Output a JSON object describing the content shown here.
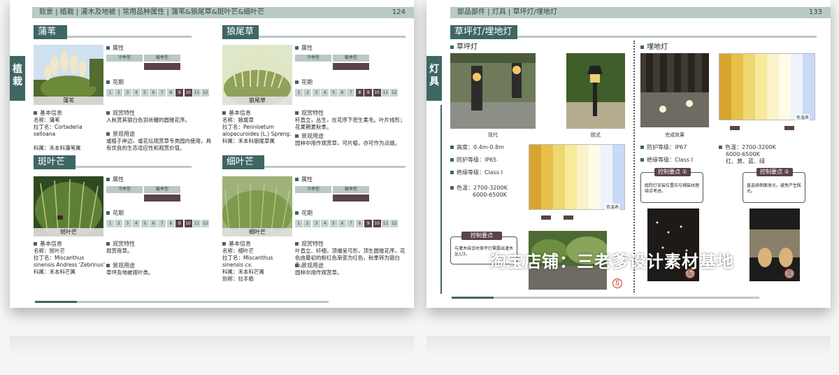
{
  "left_page": {
    "breadcrumb": "软景 | 植栽 | 灌木及地被 | 常用品种属性 | 蒲苇&狼尾草&斑叶芒&细叶芒",
    "page_number": "124",
    "side_tab": "植栽",
    "labels": {
      "attribute": "属性",
      "cool": "冷季型",
      "warm": "暖季型",
      "flowering": "花期",
      "basic_info": "基本信息",
      "ornamental": "观赏特性",
      "landscape_use": "景观用途"
    },
    "months": [
      "1",
      "2",
      "3",
      "4",
      "5",
      "6",
      "7",
      "8",
      "9",
      "10",
      "11",
      "12"
    ],
    "plants": [
      {
        "title": "蒲苇",
        "photo_caption": "蒲苇",
        "warm_season": true,
        "flower_months": [
          9,
          10
        ],
        "name_line": "名称：蒲苇",
        "latin_line": "拉丁名：Cortaderia selloana",
        "family_line": "科属：禾本科蒲苇属",
        "ornamental_text": "入秋赏其银白色羽状穗的圆锥花序。",
        "use_text": "或植于岸边，或花坛观赏草专类园内使用，具有优良的生态适应性和观赏价值。"
      },
      {
        "title": "狼尾草",
        "photo_caption": "狼尾草",
        "warm_season": true,
        "flower_months": [
          8,
          9,
          10
        ],
        "name_line": "名称：狼尾草",
        "latin_line": "拉丁名：Pennisetum alopecuroides (L.) Spreng.",
        "family_line": "科属：禾本科狼尾草属",
        "ornamental_text": "秆直立，丛生，在花序下密生柔毛。叶片线形；花果期夏秋季。",
        "use_text": "园林中用作观赏草，可片植，亦可作为点缀。"
      },
      {
        "title": "斑叶芒",
        "photo_caption": "斑叶芒",
        "warm_season": true,
        "flower_months": [
          9,
          10
        ],
        "name_line": "名称：斑叶芒",
        "latin_line": "拉丁名：Miscanthus sinensis Andress 'Zebrinus'",
        "family_line": "科属：禾本科芒属",
        "ornamental_text": "观赏夜草。",
        "use_text": "草坪及地被观叶类。"
      },
      {
        "title": "细叶芒",
        "photo_caption": "细叶芒",
        "warm_season": true,
        "flower_months": [
          9,
          10
        ],
        "name_line": "名称：细叶芒",
        "latin_line": "拉丁名：Miscanthus sinensis cv.",
        "family_line": "科属：禾本科芒属",
        "alias_line": "别称：拉手筋",
        "ornamental_text": "叶直立、纤细，顶端呈弓形，顶生圆锥花序，花色由最初的粉红色渐变为红色，秋季转为银白色。",
        "use_text": "园林中用作观赏草。"
      }
    ]
  },
  "right_page": {
    "breadcrumb": "部品部件 | 灯具 | 草坪灯/埋地灯",
    "page_number": "133",
    "side_tab": "灯具",
    "section_title": "草坪灯/埋地灯",
    "lawn": {
      "title": "草坪灯",
      "photo_captions": [
        "现代",
        "欧式"
      ],
      "specs": [
        "高度：0.4m-0.8m",
        "防护等级：IP65",
        "绝缘等级：Class Ⅰ",
        "色温：2700-3200K",
        "6000-6500K"
      ],
      "control_label": "控制要点",
      "control_text": "与灌木结合时草坪灯需露出灌木丛1/3。"
    },
    "buried": {
      "title": "埋地灯",
      "photo_caption": "完成效果",
      "specs_left": [
        "防护等级：IP67",
        "绝缘等级：Class Ⅰ"
      ],
      "specs_right": [
        "色温：2700-3200K",
        "6000-6500K",
        "红、黄、蓝、绿"
      ],
      "control1_label": "控制要点 ①",
      "control1_text": "庭院灯安装位置应与铺装纹理结合考虑。",
      "control2_label": "控制要点 ②",
      "control2_text": "直选择侧面发光，避免产生眩光。"
    },
    "spectrum_label": "色温表",
    "stamp_char": "互"
  },
  "watermark": "淘宝店铺：三老爹设计素材基地"
}
